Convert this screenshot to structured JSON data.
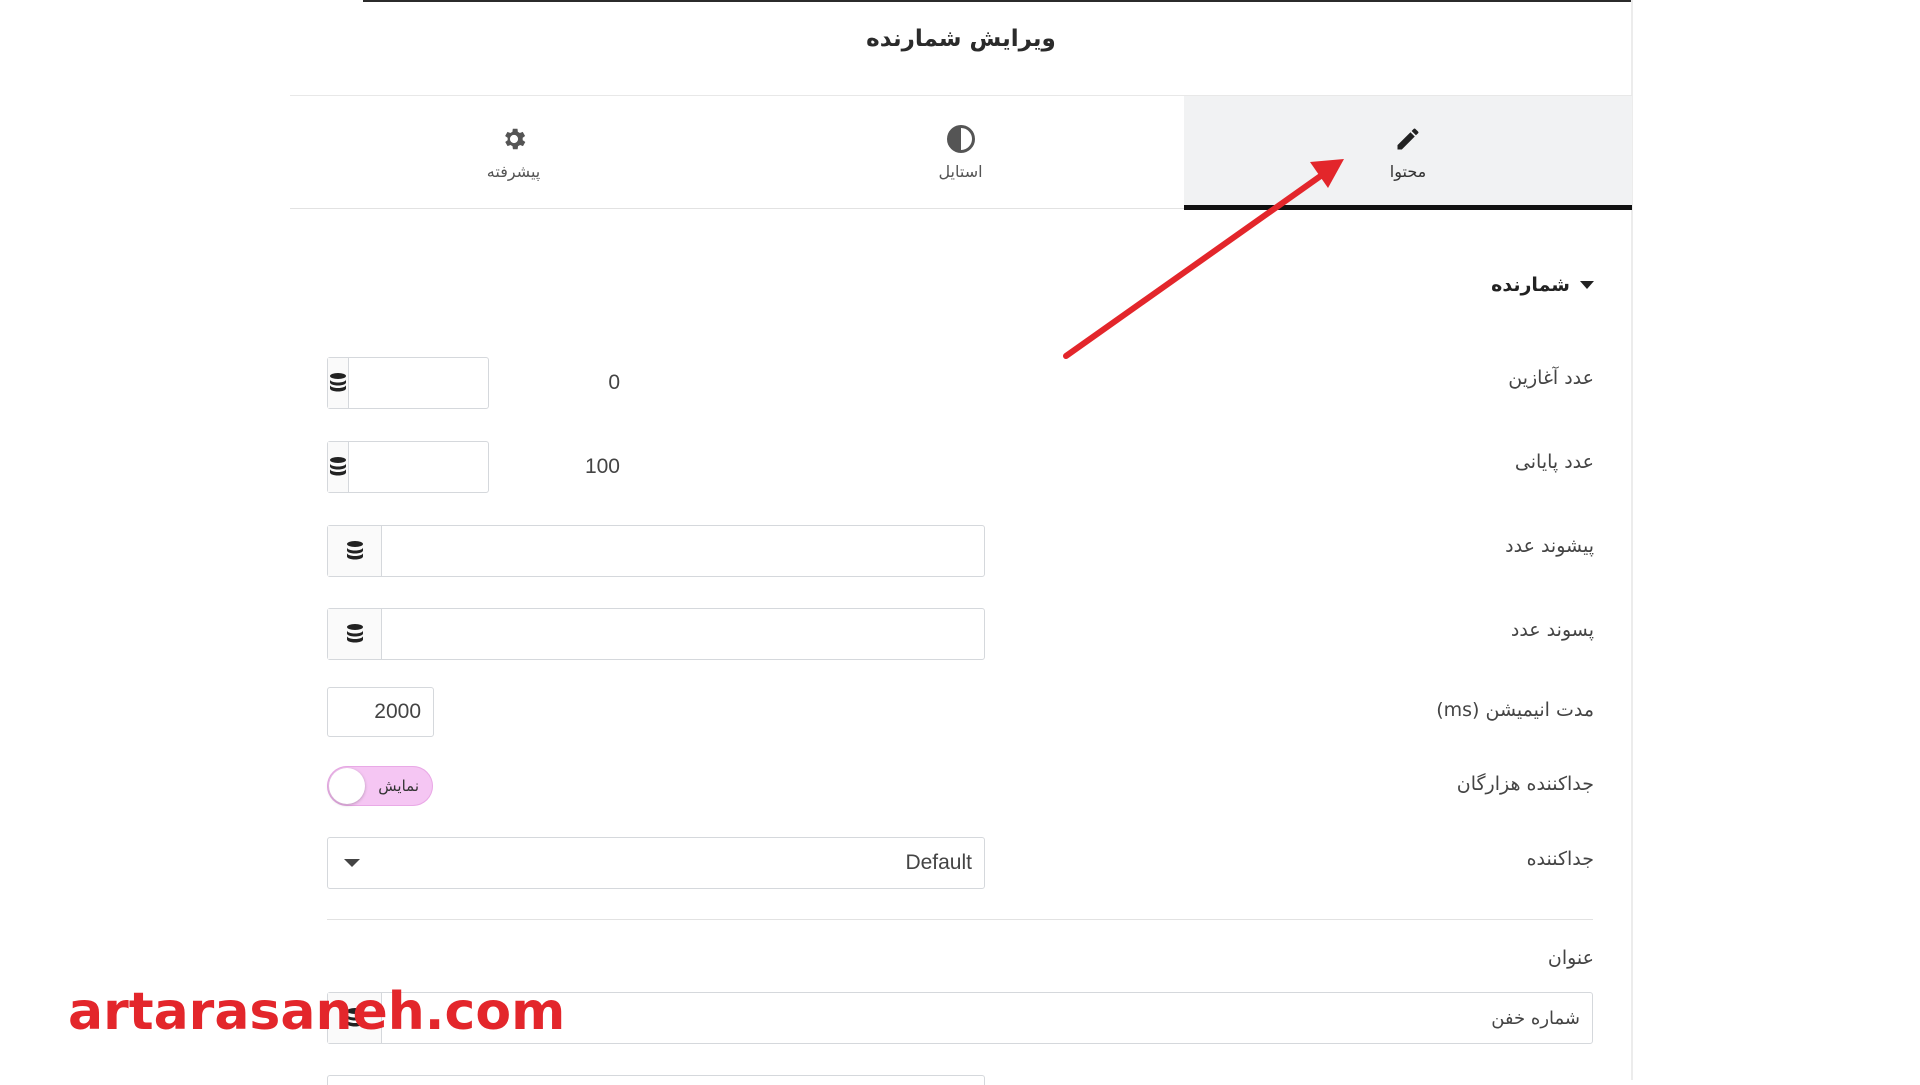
{
  "panel": {
    "title": "ویرایش شمارنده"
  },
  "tabs": [
    {
      "label": "محتوا",
      "icon": "pencil-icon",
      "active": true
    },
    {
      "label": "استایل",
      "icon": "half-circle-icon",
      "active": false
    },
    {
      "label": "پیشرفته",
      "icon": "gear-icon",
      "active": false
    }
  ],
  "section": {
    "title": "شمارنده",
    "expanded": true
  },
  "fields": {
    "start_number": {
      "label": "عدد آغازین",
      "value": "0"
    },
    "end_number": {
      "label": "عدد پایانی",
      "value": "100"
    },
    "number_prefix": {
      "label": "پیشوند عدد",
      "value": ""
    },
    "number_suffix": {
      "label": "پسوند عدد",
      "value": ""
    },
    "animation_duration": {
      "label": "مدت انیمیشن (ms)",
      "value": "2000"
    },
    "thousand_separator": {
      "label": "جداکننده هزارگان",
      "toggle_text": "نمایش",
      "on": true
    },
    "separator": {
      "label": "جداکننده",
      "selected": "Default"
    },
    "title_field": {
      "label": "عنوان",
      "value": "شماره خفن"
    }
  },
  "watermark": {
    "text": "artarasaneh.com"
  },
  "colors": {
    "accent_toggle": "#f5c6f3",
    "annotation_arrow": "#e3262b",
    "active_tab_bg": "#f1f2f3",
    "active_tab_underline": "#111111"
  }
}
